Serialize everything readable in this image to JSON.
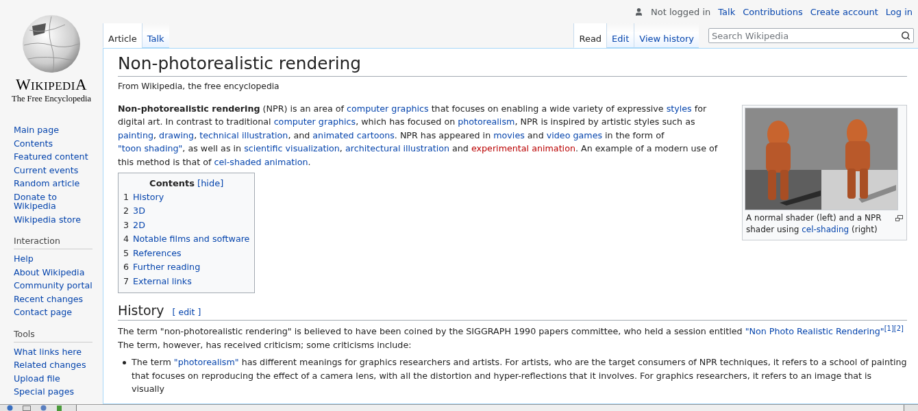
{
  "logo": {
    "wordmark": "WIKIPEDIA",
    "tagline": "The Free Encyclopedia"
  },
  "sidebar": {
    "main": [
      "Main page",
      "Contents",
      "Featured content",
      "Current events",
      "Random article",
      "Donate to Wikipedia",
      "Wikipedia store"
    ],
    "sections": [
      {
        "heading": "Interaction",
        "items": [
          "Help",
          "About Wikipedia",
          "Community portal",
          "Recent changes",
          "Contact page"
        ]
      },
      {
        "heading": "Tools",
        "items": [
          "What links here",
          "Related changes",
          "Upload file",
          "Special pages"
        ]
      }
    ]
  },
  "personal": {
    "status": "Not logged in",
    "links": [
      "Talk",
      "Contributions",
      "Create account",
      "Log in"
    ]
  },
  "namespace_tabs": [
    {
      "label": "Article",
      "selected": true
    },
    {
      "label": "Talk",
      "selected": false
    }
  ],
  "view_tabs": [
    {
      "label": "Read",
      "selected": true
    },
    {
      "label": "Edit",
      "selected": false
    },
    {
      "label": "View history",
      "selected": false
    }
  ],
  "search": {
    "placeholder": "Search Wikipedia"
  },
  "article": {
    "title": "Non-photorealistic rendering",
    "tagline": "From Wikipedia, the free encyclopedia",
    "lead": [
      {
        "kind": "bold",
        "text": "Non-photorealistic rendering"
      },
      {
        "kind": "plain",
        "text": " (NPR) is an area of "
      },
      {
        "kind": "link",
        "text": "computer graphics"
      },
      {
        "kind": "plain",
        "text": " that focuses on enabling a wide variety of expressive "
      },
      {
        "kind": "link",
        "text": "styles"
      },
      {
        "kind": "plain",
        "text": " for digital art. In contrast to traditional "
      },
      {
        "kind": "link",
        "text": "computer graphics"
      },
      {
        "kind": "plain",
        "text": ", which has focused on "
      },
      {
        "kind": "link",
        "text": "photorealism"
      },
      {
        "kind": "plain",
        "text": ", NPR is inspired by artistic styles such as "
      },
      {
        "kind": "link",
        "text": "painting"
      },
      {
        "kind": "plain",
        "text": ", "
      },
      {
        "kind": "link",
        "text": "drawing"
      },
      {
        "kind": "plain",
        "text": ", "
      },
      {
        "kind": "link",
        "text": "technical illustration"
      },
      {
        "kind": "plain",
        "text": ", and "
      },
      {
        "kind": "link",
        "text": "animated cartoons"
      },
      {
        "kind": "plain",
        "text": ". NPR has appeared in "
      },
      {
        "kind": "link",
        "text": "movies"
      },
      {
        "kind": "plain",
        "text": " and "
      },
      {
        "kind": "link",
        "text": "video games"
      },
      {
        "kind": "plain",
        "text": " in the form of "
      },
      {
        "kind": "link",
        "text": "\"toon shading\""
      },
      {
        "kind": "plain",
        "text": ", as well as in "
      },
      {
        "kind": "link",
        "text": "scientific visualization"
      },
      {
        "kind": "plain",
        "text": ", "
      },
      {
        "kind": "link",
        "text": "architectural illustration"
      },
      {
        "kind": "plain",
        "text": " and "
      },
      {
        "kind": "redlink",
        "text": "experimental animation"
      },
      {
        "kind": "plain",
        "text": ". An example of a modern use of this method is that of "
      },
      {
        "kind": "link",
        "text": "cel-shaded animation"
      },
      {
        "kind": "plain",
        "text": "."
      }
    ],
    "thumb": {
      "caption": [
        {
          "kind": "plain",
          "text": "A normal shader (left) and a NPR shader using "
        },
        {
          "kind": "link",
          "text": "cel-shading"
        },
        {
          "kind": "plain",
          "text": " (right)"
        }
      ]
    },
    "toc": {
      "title": "Contents",
      "toggle": "[hide]",
      "items": [
        {
          "number": "1",
          "label": "History"
        },
        {
          "number": "2",
          "label": "3D"
        },
        {
          "number": "3",
          "label": "2D"
        },
        {
          "number": "4",
          "label": "Notable films and software"
        },
        {
          "number": "5",
          "label": "References"
        },
        {
          "number": "6",
          "label": "Further reading"
        },
        {
          "number": "7",
          "label": "External links"
        }
      ]
    },
    "sections": [
      {
        "heading": "History",
        "edit": "[ edit ]",
        "paragraph": [
          {
            "kind": "plain",
            "text": "The term \"non-photorealistic rendering\" is believed to have been coined by the SIGGRAPH 1990 papers committee, who held a session entitled "
          },
          {
            "kind": "link",
            "text": "\"Non Photo Realistic Rendering\""
          },
          {
            "kind": "sup",
            "text": "[1]"
          },
          {
            "kind": "sup",
            "text": "[2]"
          },
          {
            "kind": "plain",
            "text": " The term, however, has received criticism; some criticisms include:"
          }
        ],
        "bullets": [
          [
            {
              "kind": "plain",
              "text": "The term "
            },
            {
              "kind": "link",
              "text": "\"photorealism\""
            },
            {
              "kind": "plain",
              "text": " has different meanings for graphics researchers and artists. For artists, who are the target consumers of NPR techniques, it refers to a school of painting that focuses on reproducing the effect of a camera lens, with all the distortion and hyper-reflections that it involves. For graphics researchers, it refers to an image that is visually"
            }
          ]
        ]
      }
    ]
  }
}
